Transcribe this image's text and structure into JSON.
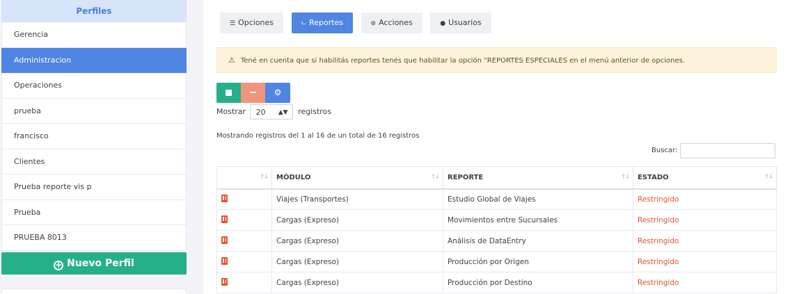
{
  "sidebar": {
    "title": "Perfiles",
    "items": [
      {
        "label": "Gerencia"
      },
      {
        "label": "Administracion",
        "active": true
      },
      {
        "label": "Operaciones"
      },
      {
        "label": "prueba"
      },
      {
        "label": "francisco"
      },
      {
        "label": "Clientes"
      },
      {
        "label": "Prueba reporte vis p"
      },
      {
        "label": "Prueba"
      },
      {
        "label": "PRUEBA 8013"
      }
    ],
    "new_button": "Nuevo Perfil"
  },
  "tabs": [
    {
      "label": "Opciones",
      "icon": "list-icon"
    },
    {
      "label": "Reportes",
      "icon": "chart-line-icon",
      "active": true
    },
    {
      "label": "Acciones",
      "icon": "broadcast-icon"
    },
    {
      "label": "Usuarios",
      "icon": "user-icon"
    }
  ],
  "warning": "Tené en cuenta que si habilitás reportes tenés que habilitar la opción \"REPORTES ESPECIALES en el menú anterior de opciones.",
  "toolbar": {
    "check_icon": "check-square-icon",
    "minus_icon": "minus-icon",
    "user_settings_icon": "user-cog-icon"
  },
  "length": {
    "prefix": "Mostrar",
    "value": "20",
    "suffix": "registros"
  },
  "info": "Mostrando registros del 1 al 16 de un total de 16 registros",
  "search": {
    "label": "Buscar:",
    "value": ""
  },
  "table": {
    "headers": [
      "",
      "MÓDULO",
      "REPORTE",
      "ESTADO"
    ],
    "rows": [
      {
        "modulo": "Viajes (Transportes)",
        "reporte": "Estudio Global de Viajes",
        "estado": "Restringido"
      },
      {
        "modulo": "Cargas (Expreso)",
        "reporte": "Movimientos entre Sucursales",
        "estado": "Restringido"
      },
      {
        "modulo": "Cargas (Expreso)",
        "reporte": "Análisis de DataEntry",
        "estado": "Restringido"
      },
      {
        "modulo": "Cargas (Expreso)",
        "reporte": "Producción por Origen",
        "estado": "Restringido"
      },
      {
        "modulo": "Cargas (Expreso)",
        "reporte": "Producción por Destino",
        "estado": "Restringido"
      }
    ]
  },
  "colors": {
    "primary": "#4f85e3",
    "success": "#26b08a",
    "danger": "#e5522f",
    "salmon": "#f0957c",
    "warning_bg": "#fdf3dc"
  }
}
